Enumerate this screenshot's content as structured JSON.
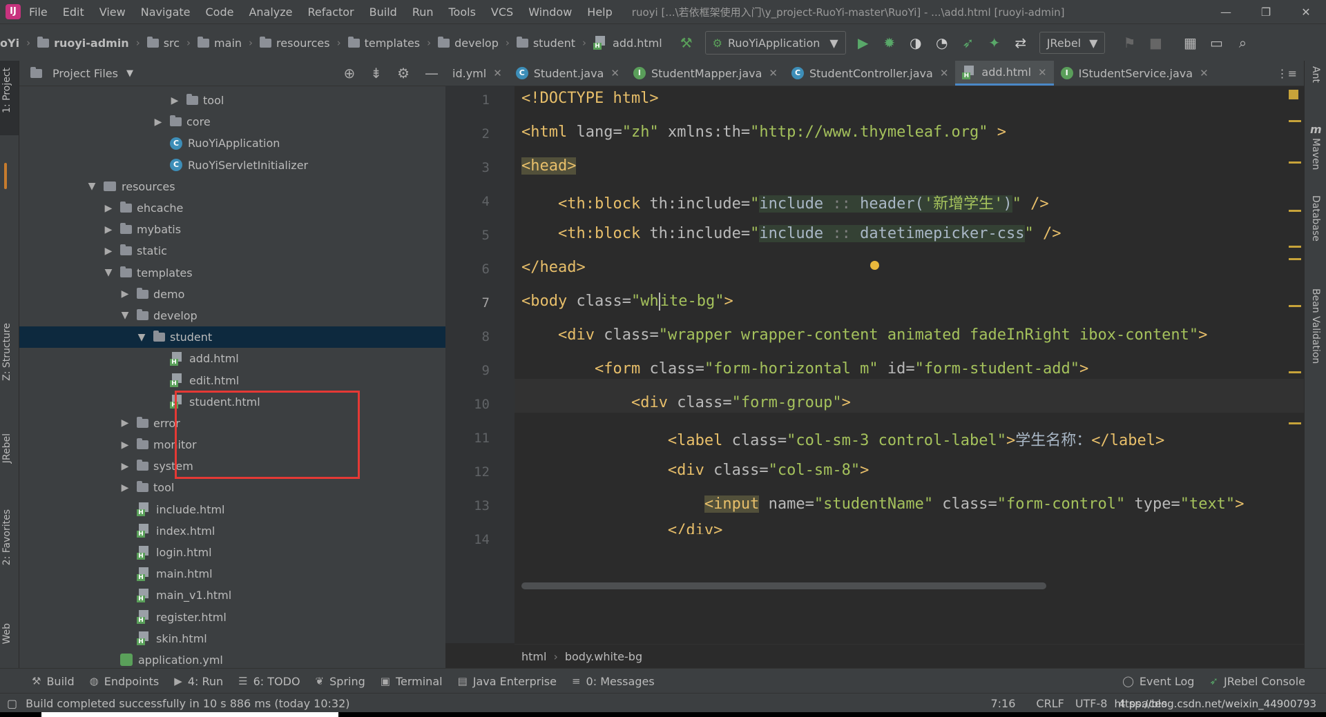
{
  "menu": {
    "items": [
      "File",
      "Edit",
      "View",
      "Navigate",
      "Code",
      "Analyze",
      "Refactor",
      "Build",
      "Run",
      "Tools",
      "VCS",
      "Window",
      "Help"
    ],
    "window_title": "ruoyi [...\\若依框架使用入门\\y_project-RuoYi-master\\RuoYi] - ...\\add.html [ruoyi-admin]"
  },
  "navbar": {
    "prefix": "oYi",
    "crumbs": [
      "ruoyi-admin",
      "src",
      "main",
      "resources",
      "templates",
      "develop",
      "student",
      "add.html"
    ],
    "run_config": "RuoYiApplication",
    "jrebel": "JRebel"
  },
  "left_stripe": {
    "project": "1: Project",
    "structure": "Z: Structure",
    "jrebel": "JRebel",
    "favorites": "2: Favorites",
    "web": "Web"
  },
  "project": {
    "title": "Project Files",
    "tree": [
      {
        "label": "tool",
        "kind": "folder",
        "depth": 9,
        "arrow": "▶"
      },
      {
        "label": "core",
        "kind": "folder",
        "depth": 8,
        "arrow": "▶"
      },
      {
        "label": "RuoYiApplication",
        "kind": "class",
        "depth": 8,
        "arrow": ""
      },
      {
        "label": "RuoYiServletInitializer",
        "kind": "class",
        "depth": 8,
        "arrow": ""
      },
      {
        "label": "resources",
        "kind": "res",
        "depth": 4,
        "arrow": "▼"
      },
      {
        "label": "ehcache",
        "kind": "folder",
        "depth": 5,
        "arrow": "▶"
      },
      {
        "label": "mybatis",
        "kind": "folder",
        "depth": 5,
        "arrow": "▶"
      },
      {
        "label": "static",
        "kind": "folder",
        "depth": 5,
        "arrow": "▶"
      },
      {
        "label": "templates",
        "kind": "folder",
        "depth": 5,
        "arrow": "▼"
      },
      {
        "label": "demo",
        "kind": "folder",
        "depth": 6,
        "arrow": "▶"
      },
      {
        "label": "develop",
        "kind": "folder",
        "depth": 6,
        "arrow": "▼"
      },
      {
        "label": "student",
        "kind": "folder",
        "depth": 7,
        "arrow": "▼",
        "selected": true
      },
      {
        "label": "add.html",
        "kind": "html",
        "depth": 8,
        "arrow": ""
      },
      {
        "label": "edit.html",
        "kind": "html",
        "depth": 8,
        "arrow": ""
      },
      {
        "label": "student.html",
        "kind": "html",
        "depth": 8,
        "arrow": ""
      },
      {
        "label": "error",
        "kind": "folder",
        "depth": 6,
        "arrow": "▶"
      },
      {
        "label": "monitor",
        "kind": "folder",
        "depth": 6,
        "arrow": "▶"
      },
      {
        "label": "system",
        "kind": "folder",
        "depth": 6,
        "arrow": "▶"
      },
      {
        "label": "tool",
        "kind": "folder",
        "depth": 6,
        "arrow": "▶"
      },
      {
        "label": "include.html",
        "kind": "html",
        "depth": 6,
        "arrow": ""
      },
      {
        "label": "index.html",
        "kind": "html",
        "depth": 6,
        "arrow": ""
      },
      {
        "label": "login.html",
        "kind": "html",
        "depth": 6,
        "arrow": ""
      },
      {
        "label": "main.html",
        "kind": "html",
        "depth": 6,
        "arrow": ""
      },
      {
        "label": "main_v1.html",
        "kind": "html",
        "depth": 6,
        "arrow": ""
      },
      {
        "label": "register.html",
        "kind": "html",
        "depth": 6,
        "arrow": ""
      },
      {
        "label": "skin.html",
        "kind": "html",
        "depth": 6,
        "arrow": ""
      },
      {
        "label": "application.yml",
        "kind": "yml",
        "depth": 5,
        "arrow": ""
      }
    ]
  },
  "tabs": [
    {
      "label": "id.yml",
      "icon": "",
      "active": false
    },
    {
      "label": "Student.java",
      "icon": "C",
      "active": false
    },
    {
      "label": "StudentMapper.java",
      "icon": "I",
      "active": false
    },
    {
      "label": "StudentController.java",
      "icon": "C",
      "active": false
    },
    {
      "label": "add.html",
      "icon": "H",
      "active": true
    },
    {
      "label": "IStudentService.java",
      "icon": "I",
      "active": false
    }
  ],
  "editor": {
    "line_numbers": [
      "1",
      "2",
      "3",
      "4",
      "5",
      "6",
      "7",
      "8",
      "9",
      "10",
      "11",
      "12",
      "13",
      "14"
    ],
    "breadcrumb": [
      "html",
      "body.white-bg"
    ]
  },
  "right_stripe": {
    "ant": "Ant",
    "maven": "Maven",
    "database": "Database",
    "bean_validation": "Bean Validation"
  },
  "tool_windows": {
    "build": "Build",
    "endpoints": "Endpoints",
    "run": "4: Run",
    "todo": "6: TODO",
    "spring": "Spring",
    "terminal": "Terminal",
    "java_enterprise": "Java Enterprise",
    "messages": "0: Messages",
    "event_log": "Event Log",
    "jrebel_console": "JRebel Console"
  },
  "status": {
    "message": "Build completed successfully in 10 s 886 ms (today 10:32)",
    "position": "7:16",
    "line_sep": "CRLF",
    "encoding": "UTF-8",
    "indent": "4 spaces"
  },
  "watermark": "https://blog.csdn.net/weixin_44900793",
  "colors": {
    "accent": "#4a88c7",
    "highlight_box": "#e53935",
    "tag": "#e8bf6a",
    "string": "#a5c25c"
  }
}
